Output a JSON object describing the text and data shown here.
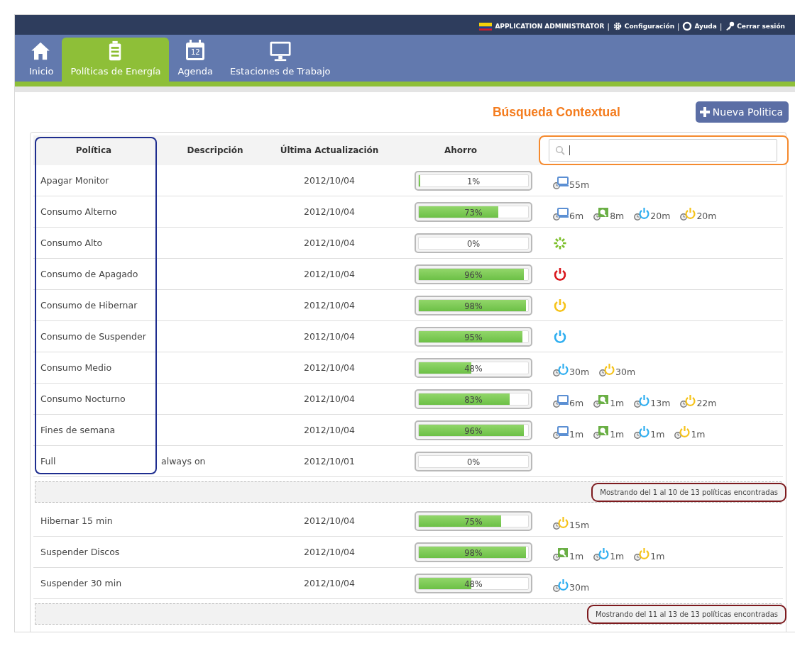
{
  "top_bar": {
    "flag": true,
    "user": "APPLICATION ADMINISTRATOR",
    "links": [
      {
        "separator": "|",
        "label": "Configuración",
        "kind": "settings"
      },
      {
        "separator": "|",
        "label": "Ayuda",
        "kind": "help"
      },
      {
        "separator": "|",
        "label": "Cerrar sesión",
        "kind": "logout"
      }
    ]
  },
  "tabs": [
    {
      "label": "Inicio",
      "kind": "home",
      "selected": false
    },
    {
      "label": "Políticas de Energía",
      "kind": "battery",
      "selected": true
    },
    {
      "label": "Agenda",
      "kind": "calendar",
      "icon_text": "12",
      "selected": false
    },
    {
      "label": "Estaciones de Trabajo",
      "kind": "monitor",
      "selected": false
    }
  ],
  "title": "Búsqueda Contextual",
  "new_button": "Nueva Politica",
  "table": {
    "columns": [
      "Política",
      "Descripción",
      "Última Actualización",
      "Ahorro"
    ],
    "pages": [
      {
        "rows": [
          {
            "name": "Apagar Monitor",
            "date": "2012/10/04",
            "level": 0.01,
            "reading": "1%",
            "timers": [
              {
                "kind": "monitor",
                "label": "55m"
              }
            ]
          },
          {
            "name": "Consumo Alterno",
            "date": "2012/10/04",
            "level": 0.73,
            "reading": "73%",
            "timers": [
              {
                "kind": "monitor",
                "label": "6m"
              },
              {
                "kind": "disk",
                "label": "8m"
              },
              {
                "kind": "suspend",
                "label": "20m"
              },
              {
                "kind": "hibernate",
                "label": "20m"
              }
            ]
          },
          {
            "name": "Consumo Alto",
            "date": "2012/10/04",
            "level": 0,
            "reading": "0%",
            "timers": [
              {
                "kind": "active"
              }
            ]
          },
          {
            "name": "Consumo de Apagado",
            "date": "2012/10/04",
            "level": 0.96,
            "reading": "96%",
            "timers": [
              {
                "kind": "shutdown"
              }
            ]
          },
          {
            "name": "Consumo de Hibernar",
            "date": "2012/10/04",
            "level": 0.98,
            "reading": "98%",
            "timers": [
              {
                "kind": "hibernate_now"
              }
            ]
          },
          {
            "name": "Consumo de Suspender",
            "date": "2012/10/04",
            "level": 0.95,
            "reading": "95%",
            "timers": [
              {
                "kind": "suspend_now"
              }
            ]
          },
          {
            "name": "Consumo Medio",
            "date": "2012/10/04",
            "level": 0.48,
            "reading": "48%",
            "timers": [
              {
                "kind": "suspend",
                "label": "30m"
              },
              {
                "kind": "hibernate",
                "label": "30m"
              }
            ]
          },
          {
            "name": "Consumo Nocturno",
            "date": "2012/10/04",
            "level": 0.83,
            "reading": "83%",
            "timers": [
              {
                "kind": "monitor",
                "label": "6m"
              },
              {
                "kind": "disk",
                "label": "1m"
              },
              {
                "kind": "suspend",
                "label": "13m"
              },
              {
                "kind": "hibernate",
                "label": "22m"
              }
            ]
          },
          {
            "name": "Fines de semana",
            "date": "2012/10/04",
            "level": 0.96,
            "reading": "96%",
            "timers": [
              {
                "kind": "monitor",
                "label": "1m"
              },
              {
                "kind": "disk",
                "label": "1m"
              },
              {
                "kind": "suspend",
                "label": "1m"
              },
              {
                "kind": "hibernate",
                "label": "1m"
              }
            ]
          },
          {
            "name": "Full",
            "description": "always on",
            "date": "2012/10/01",
            "level": 0,
            "reading": "0%"
          }
        ],
        "footer": "Mostrando del 1 al 10 de 13 políticas encontradas"
      },
      {
        "rows": [
          {
            "name": "Hibernar 15 min",
            "date": "2012/10/04",
            "level": 0.75,
            "reading": "75%",
            "timers": [
              {
                "kind": "hibernate",
                "label": "15m"
              }
            ]
          },
          {
            "name": "Suspender Discos",
            "date": "2012/10/04",
            "level": 0.98,
            "reading": "98%",
            "timers": [
              {
                "kind": "disk",
                "label": "1m"
              },
              {
                "kind": "suspend",
                "label": "1m"
              },
              {
                "kind": "hibernate",
                "label": "1m"
              }
            ]
          },
          {
            "name": "Suspender 30 min",
            "date": "2012/10/04",
            "level": 0.48,
            "reading": "48%",
            "timers": [
              {
                "kind": "suspend",
                "label": "30m"
              }
            ]
          }
        ],
        "footer": "Mostrando del 11 al 13 de 13 políticas encontradas"
      }
    ]
  }
}
